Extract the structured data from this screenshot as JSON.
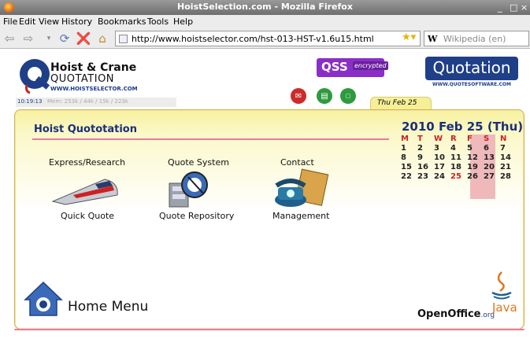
{
  "window": {
    "title": "HoistSelection.com - Mozilla Firefox",
    "buttons": [
      "_",
      "□",
      "×"
    ]
  },
  "menu": [
    "File",
    "Edit",
    "View",
    "History",
    "Bookmarks",
    "Tools",
    "Help"
  ],
  "nav": {
    "url": "http://www.hoistselector.com/hst-013-HST-v1.6u15.html",
    "search_engine": "W",
    "search_placeholder": "Wikipedia (en)"
  },
  "header": {
    "logo_line1": "Hoist & Crane",
    "logo_line2": "QUOTATION",
    "logo_url": "WWW.HOISTSELECTOR.COM",
    "time": "10:19:13",
    "mem": "Mem: 253k / 44k / 15k / 223k",
    "qss": "QSS",
    "qss_badge": "encrypted",
    "quotation": "Quotation",
    "quotation_url": "WWW.QUOTESOFTWARE.COM",
    "date_tab": "Thu Feb 25"
  },
  "main": {
    "title": "Hoist Quototation",
    "items": [
      {
        "top": "Express/Research",
        "bottom": "Quick Quote"
      },
      {
        "top": "Quote System",
        "bottom": "Quote Repository"
      },
      {
        "top": "Contact",
        "bottom": "Management"
      }
    ],
    "home": "Home Menu"
  },
  "calendar": {
    "title": "2010 Feb 25 (Thu)",
    "headers": [
      "M",
      "T",
      "W",
      "R",
      "F",
      "S",
      "N"
    ],
    "weeks": [
      [
        "1",
        "2",
        "3",
        "4",
        "5",
        "6",
        "7"
      ],
      [
        "8",
        "9",
        "10",
        "11",
        "12",
        "13",
        "14"
      ],
      [
        "15",
        "16",
        "17",
        "18",
        "19",
        "20",
        "21"
      ],
      [
        "22",
        "23",
        "24",
        "25",
        "26",
        "27",
        "28"
      ]
    ],
    "today": "25"
  },
  "footer": {
    "openoffice": "OpenOffice",
    "openoffice_suffix": ".org",
    "java": "Java"
  }
}
